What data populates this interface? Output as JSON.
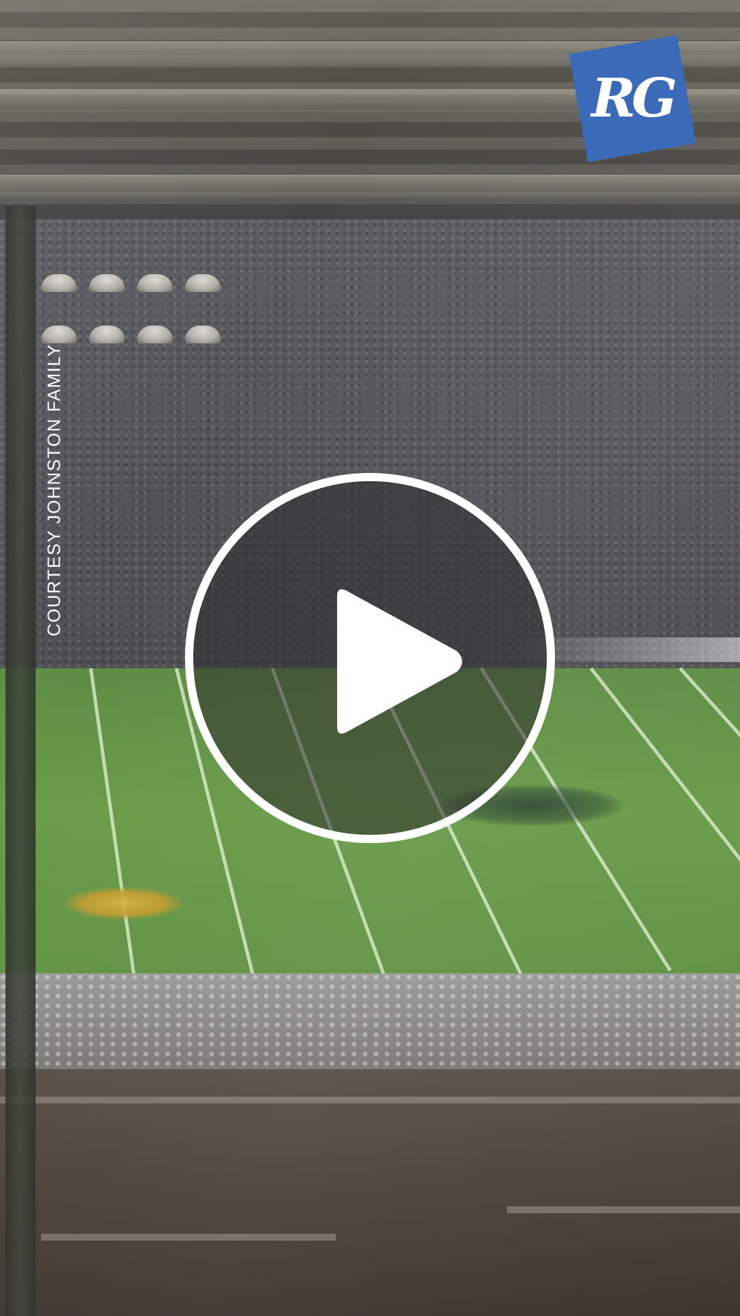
{
  "video": {
    "credit_text": "COURTESY JOHNSTON FAMILY",
    "brand_logo_text": "RG",
    "play_icon": "play-icon"
  },
  "colors": {
    "logo_background": "#3b6ab9",
    "overlay_text": "#ffffff",
    "play_ring": "#ffffff"
  }
}
